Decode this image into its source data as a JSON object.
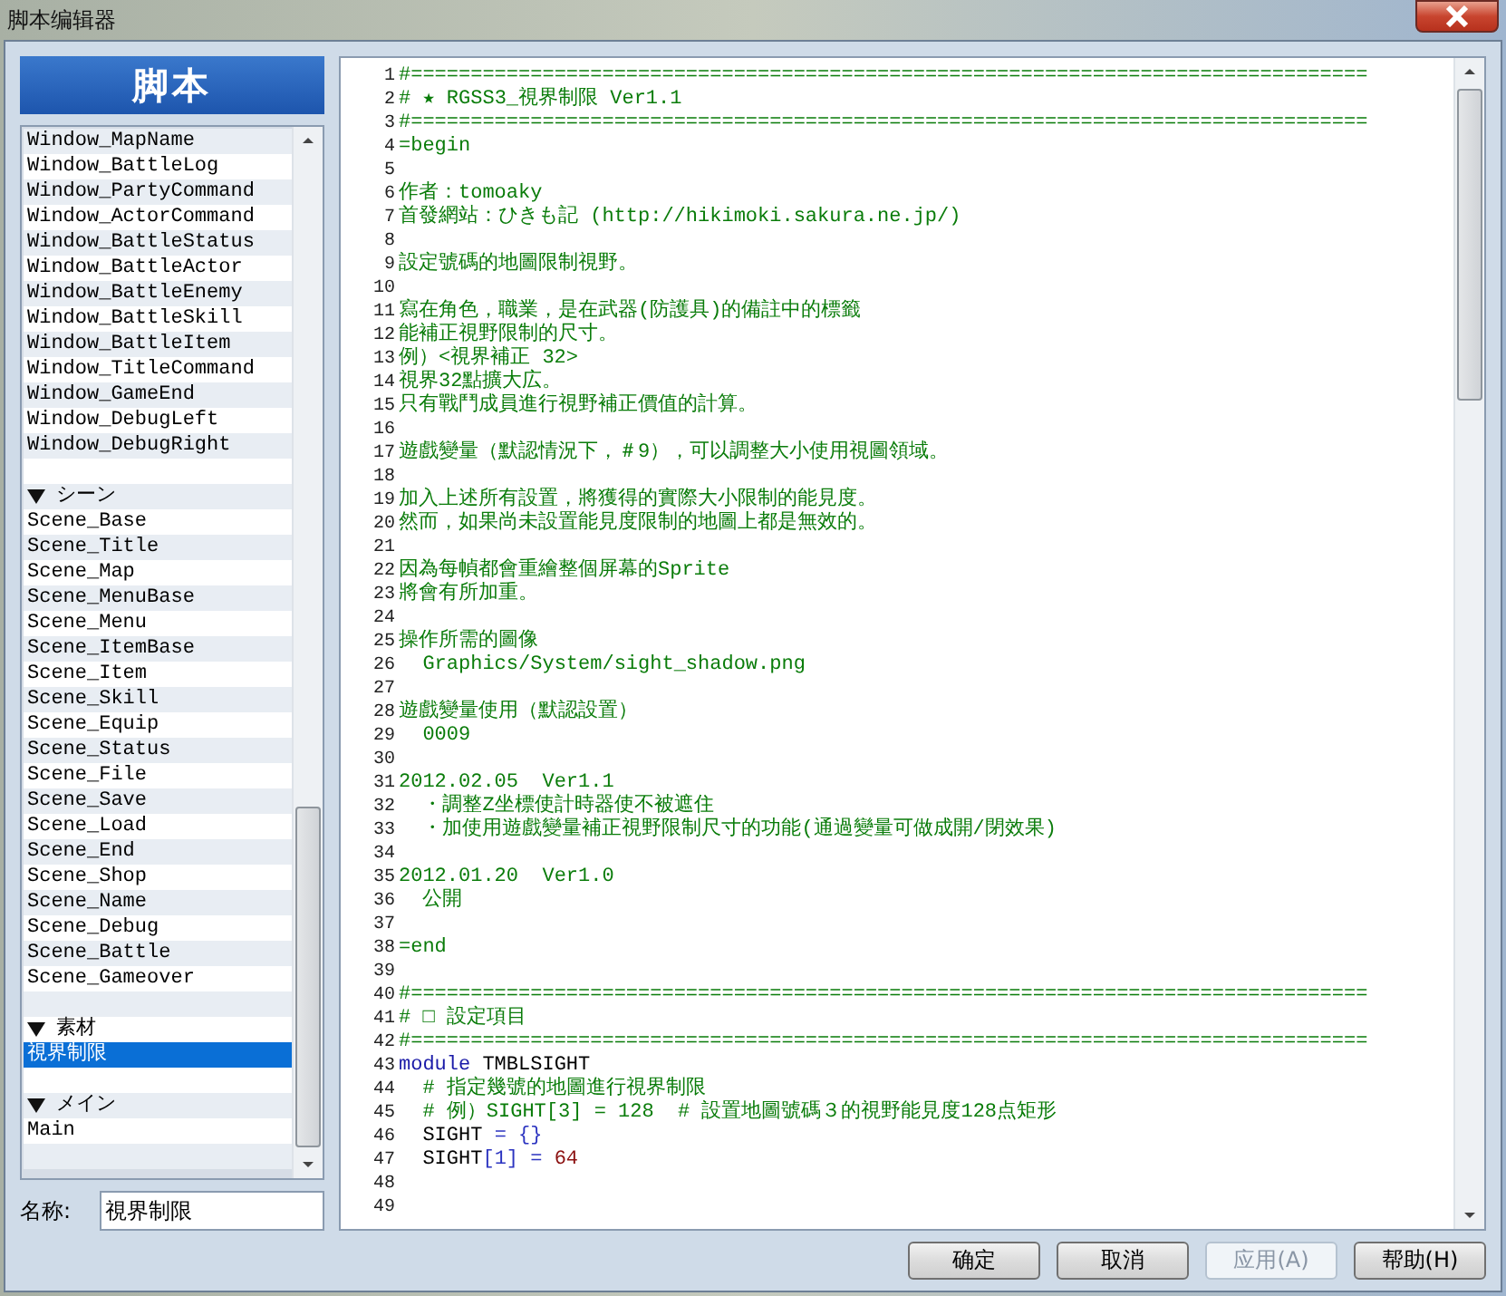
{
  "window": {
    "title": "脚本编辑器"
  },
  "sidebar": {
    "header": "脚本",
    "items": [
      {
        "kind": "item",
        "label": "Window_MapName",
        "selected": false
      },
      {
        "kind": "item",
        "label": "Window_BattleLog",
        "selected": false
      },
      {
        "kind": "item",
        "label": "Window_PartyCommand",
        "selected": false
      },
      {
        "kind": "item",
        "label": "Window_ActorCommand",
        "selected": false
      },
      {
        "kind": "item",
        "label": "Window_BattleStatus",
        "selected": false
      },
      {
        "kind": "item",
        "label": "Window_BattleActor",
        "selected": false
      },
      {
        "kind": "item",
        "label": "Window_BattleEnemy",
        "selected": false
      },
      {
        "kind": "item",
        "label": "Window_BattleSkill",
        "selected": false
      },
      {
        "kind": "item",
        "label": "Window_BattleItem",
        "selected": false
      },
      {
        "kind": "item",
        "label": "Window_TitleCommand",
        "selected": false
      },
      {
        "kind": "item",
        "label": "Window_GameEnd",
        "selected": false
      },
      {
        "kind": "item",
        "label": "Window_DebugLeft",
        "selected": false
      },
      {
        "kind": "item",
        "label": "Window_DebugRight",
        "selected": false
      },
      {
        "kind": "blank",
        "selected": false
      },
      {
        "kind": "section",
        "label": "シーン",
        "selected": false
      },
      {
        "kind": "item",
        "label": "Scene_Base",
        "selected": false
      },
      {
        "kind": "item",
        "label": "Scene_Title",
        "selected": false
      },
      {
        "kind": "item",
        "label": "Scene_Map",
        "selected": false
      },
      {
        "kind": "item",
        "label": "Scene_MenuBase",
        "selected": false
      },
      {
        "kind": "item",
        "label": "Scene_Menu",
        "selected": false
      },
      {
        "kind": "item",
        "label": "Scene_ItemBase",
        "selected": false
      },
      {
        "kind": "item",
        "label": "Scene_Item",
        "selected": false
      },
      {
        "kind": "item",
        "label": "Scene_Skill",
        "selected": false
      },
      {
        "kind": "item",
        "label": "Scene_Equip",
        "selected": false
      },
      {
        "kind": "item",
        "label": "Scene_Status",
        "selected": false
      },
      {
        "kind": "item",
        "label": "Scene_File",
        "selected": false
      },
      {
        "kind": "item",
        "label": "Scene_Save",
        "selected": false
      },
      {
        "kind": "item",
        "label": "Scene_Load",
        "selected": false
      },
      {
        "kind": "item",
        "label": "Scene_End",
        "selected": false
      },
      {
        "kind": "item",
        "label": "Scene_Shop",
        "selected": false
      },
      {
        "kind": "item",
        "label": "Scene_Name",
        "selected": false
      },
      {
        "kind": "item",
        "label": "Scene_Debug",
        "selected": false
      },
      {
        "kind": "item",
        "label": "Scene_Battle",
        "selected": false
      },
      {
        "kind": "item",
        "label": "Scene_Gameover",
        "selected": false
      },
      {
        "kind": "blank",
        "selected": false
      },
      {
        "kind": "section",
        "label": "素材",
        "selected": false
      },
      {
        "kind": "item",
        "label": "視界制限",
        "selected": true
      },
      {
        "kind": "blank",
        "selected": false
      },
      {
        "kind": "section",
        "label": "メイン",
        "selected": false
      },
      {
        "kind": "item",
        "label": "Main",
        "selected": false
      },
      {
        "kind": "blank",
        "selected": false
      }
    ],
    "name_label": "名称:",
    "name_value": "視界制限"
  },
  "editor": {
    "lines": [
      {
        "no": "1",
        "parts": [
          {
            "kind": "comment",
            "text": "#================================================================================"
          }
        ]
      },
      {
        "no": "2",
        "parts": [
          {
            "kind": "comment",
            "text": "# ★ RGSS3_視界制限 Ver1.1"
          }
        ]
      },
      {
        "no": "3",
        "parts": [
          {
            "kind": "comment",
            "text": "#================================================================================"
          }
        ]
      },
      {
        "no": "4",
        "parts": [
          {
            "kind": "comment",
            "text": "=begin"
          }
        ]
      },
      {
        "no": "5"
      },
      {
        "no": "6",
        "parts": [
          {
            "kind": "comment",
            "text": "作者：tomoaky"
          }
        ]
      },
      {
        "no": "7",
        "parts": [
          {
            "kind": "comment",
            "text": "首發網站：ひきも記 (http://hikimoki.sakura.ne.jp/)"
          }
        ]
      },
      {
        "no": "8"
      },
      {
        "no": "9",
        "parts": [
          {
            "kind": "comment",
            "text": "設定號碼的地圖限制視野。"
          }
        ]
      },
      {
        "no": "10"
      },
      {
        "no": "11",
        "parts": [
          {
            "kind": "comment",
            "text": "寫在角色，職業，是在武器(防護具)的備註中的標籤"
          }
        ]
      },
      {
        "no": "12",
        "parts": [
          {
            "kind": "comment",
            "text": "能補正視野限制的尺寸。"
          }
        ]
      },
      {
        "no": "13",
        "parts": [
          {
            "kind": "comment",
            "text": "例）<視界補正 32>"
          }
        ]
      },
      {
        "no": "14",
        "parts": [
          {
            "kind": "comment",
            "text": "視界32點擴大広。"
          }
        ]
      },
      {
        "no": "15",
        "parts": [
          {
            "kind": "comment",
            "text": "只有戰鬥成員進行視野補正價值的計算。"
          }
        ]
      },
      {
        "no": "16"
      },
      {
        "no": "17",
        "parts": [
          {
            "kind": "comment",
            "text": "遊戲變量（默認情況下，＃9），可以調整大小使用視圖領域。"
          }
        ]
      },
      {
        "no": "18"
      },
      {
        "no": "19",
        "parts": [
          {
            "kind": "comment",
            "text": "加入上述所有設置，將獲得的實際大小限制的能見度。"
          }
        ]
      },
      {
        "no": "20",
        "parts": [
          {
            "kind": "comment",
            "text": "然而，如果尚未設置能見度限制的地圖上都是無效的。"
          }
        ]
      },
      {
        "no": "21"
      },
      {
        "no": "22",
        "parts": [
          {
            "kind": "comment",
            "text": "因為每幀都會重繪整個屏幕的Sprite"
          }
        ]
      },
      {
        "no": "23",
        "parts": [
          {
            "kind": "comment",
            "text": "將會有所加重。"
          }
        ]
      },
      {
        "no": "24"
      },
      {
        "no": "25",
        "parts": [
          {
            "kind": "comment",
            "text": "操作所需的圖像"
          }
        ]
      },
      {
        "no": "26",
        "parts": [
          {
            "kind": "comment",
            "text": "  Graphics/System/sight_shadow.png"
          }
        ]
      },
      {
        "no": "27"
      },
      {
        "no": "28",
        "parts": [
          {
            "kind": "comment",
            "text": "遊戲變量使用（默認設置）"
          }
        ]
      },
      {
        "no": "29",
        "parts": [
          {
            "kind": "comment",
            "text": "  0009"
          }
        ]
      },
      {
        "no": "30"
      },
      {
        "no": "31",
        "parts": [
          {
            "kind": "comment",
            "text": "2012.02.05  Ver1.1"
          }
        ]
      },
      {
        "no": "32",
        "parts": [
          {
            "kind": "comment",
            "text": "  ・調整Z坐標使計時器使不被遮住"
          }
        ]
      },
      {
        "no": "33",
        "parts": [
          {
            "kind": "comment",
            "text": "  ・加使用遊戲變量補正視野限制尺寸的功能(通過變量可做成開/閉效果)"
          }
        ]
      },
      {
        "no": "34"
      },
      {
        "no": "35",
        "parts": [
          {
            "kind": "comment",
            "text": "2012.01.20  Ver1.0"
          }
        ]
      },
      {
        "no": "36",
        "parts": [
          {
            "kind": "comment",
            "text": "  公開"
          }
        ]
      },
      {
        "no": "37"
      },
      {
        "no": "38",
        "parts": [
          {
            "kind": "comment",
            "text": "=end"
          }
        ]
      },
      {
        "no": "39"
      },
      {
        "no": "40",
        "parts": [
          {
            "kind": "comment",
            "text": "#================================================================================"
          }
        ]
      },
      {
        "no": "41",
        "parts": [
          {
            "kind": "comment",
            "text": "# □ 設定項目"
          }
        ]
      },
      {
        "no": "42",
        "parts": [
          {
            "kind": "comment",
            "text": "#================================================================================"
          }
        ]
      },
      {
        "no": "43",
        "parts": [
          {
            "kind": "keyword",
            "text": "module"
          },
          {
            "kind": "plain",
            "text": " TMBLSIGHT"
          }
        ]
      },
      {
        "no": "44",
        "parts": [
          {
            "kind": "comment",
            "text": "  # 指定幾號的地圖進行視界制限"
          }
        ]
      },
      {
        "no": "45",
        "parts": [
          {
            "kind": "comment",
            "text": "  # 例）SIGHT[3] = 128  # 設置地圖號碼３的視野能見度128点矩形"
          }
        ]
      },
      {
        "no": "46",
        "parts": [
          {
            "kind": "plain",
            "text": "  SIGHT"
          },
          {
            "kind": "operator",
            "text": " = {}"
          }
        ]
      },
      {
        "no": "47",
        "parts": [
          {
            "kind": "plain",
            "text": "  SIGHT"
          },
          {
            "kind": "operator",
            "text": "[1] = "
          },
          {
            "kind": "number",
            "text": "64"
          }
        ]
      },
      {
        "no": "48"
      },
      {
        "no": "49"
      }
    ]
  },
  "buttons": [
    {
      "label": "确定",
      "disabled": false
    },
    {
      "label": "取消",
      "disabled": false
    },
    {
      "label": "应用(A)",
      "disabled": true
    },
    {
      "label": "帮助(H)",
      "disabled": false
    }
  ]
}
